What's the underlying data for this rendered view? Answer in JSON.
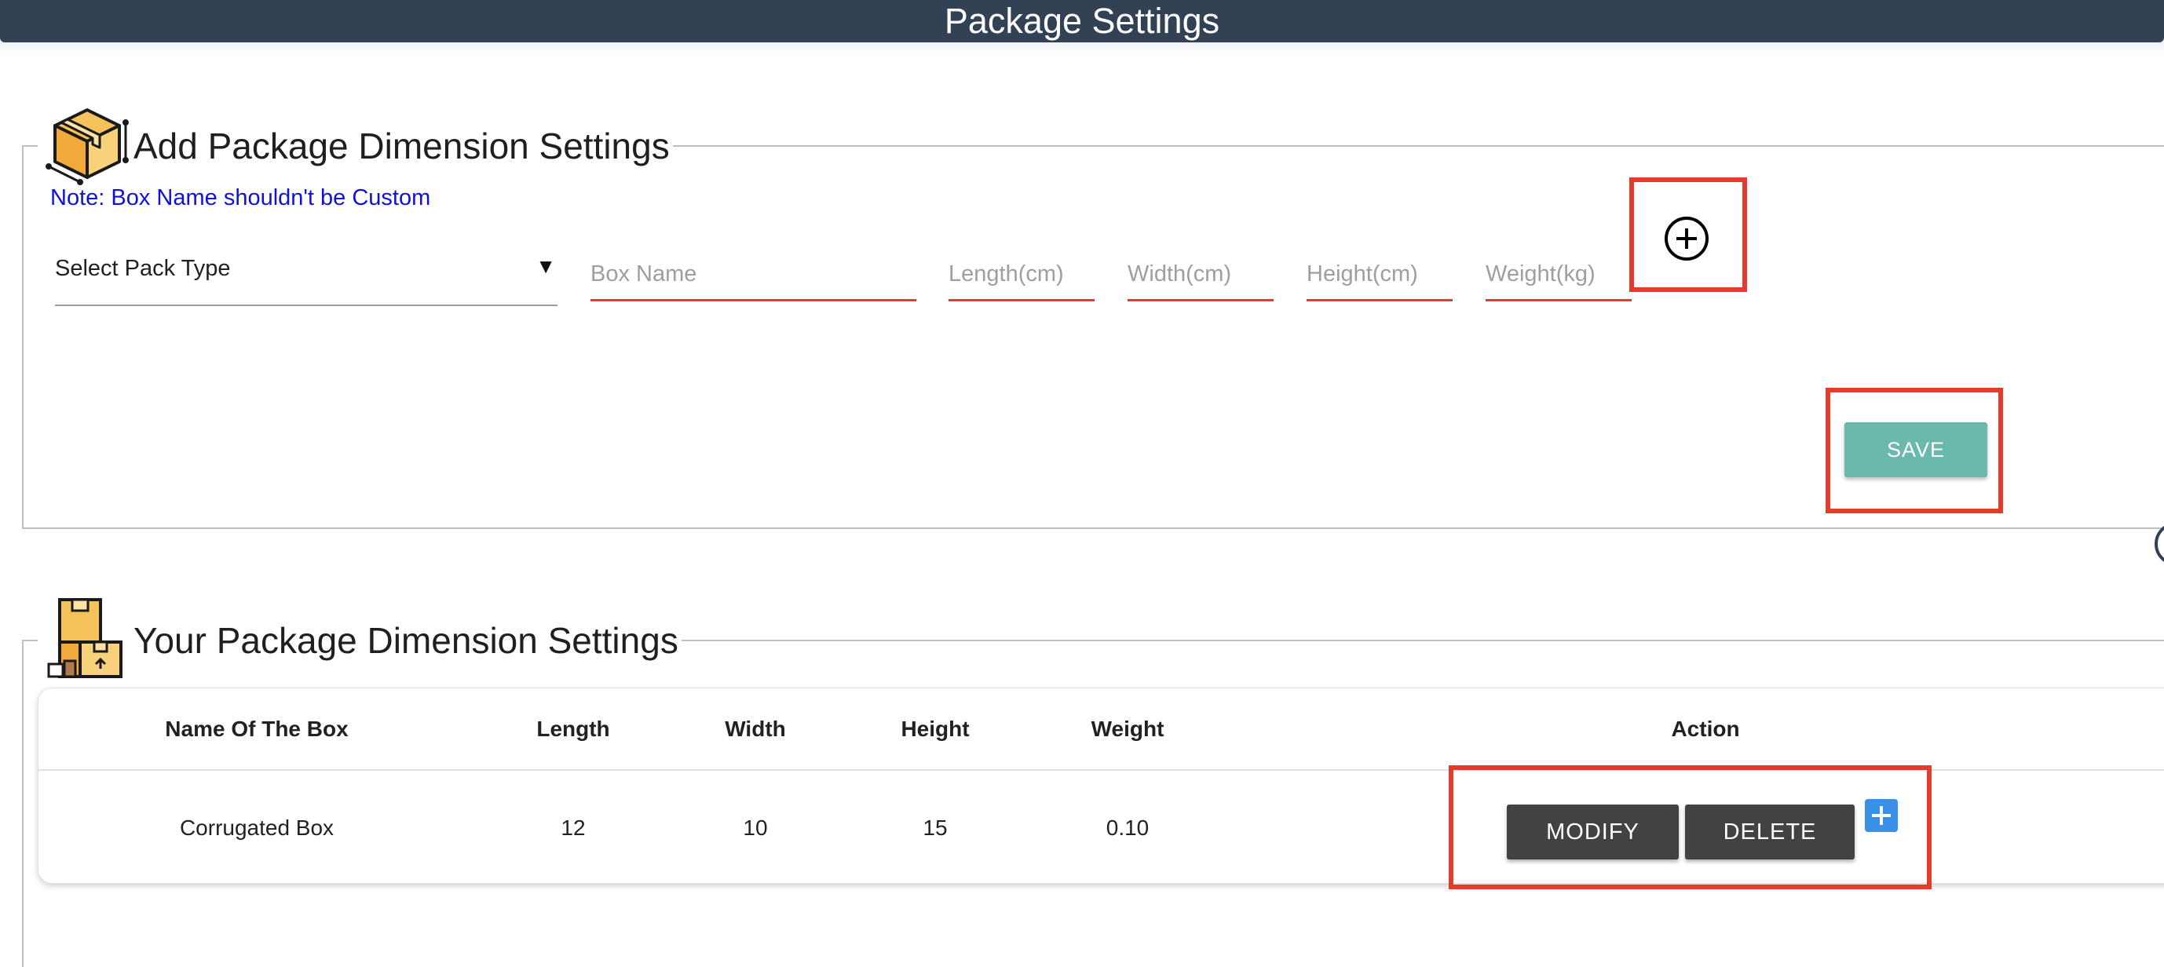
{
  "header": {
    "title": "Package Settings"
  },
  "add_section": {
    "title": "Add Package Dimension Settings",
    "icon": "package-box-icon",
    "note": "Note: Box Name shouldn't be Custom",
    "pack_type_select": {
      "value": "Select Pack Type"
    },
    "fields": {
      "box_name_placeholder": "Box Name",
      "length_placeholder": "Length(cm)",
      "width_placeholder": "Width(cm)",
      "height_placeholder": "Height(cm)",
      "weight_placeholder": "Weight(kg)"
    },
    "add_icon": "plus-circle-icon",
    "save_label": "SAVE"
  },
  "list_section": {
    "title": "Your Package Dimension Settings",
    "icon": "stacked-boxes-icon",
    "table": {
      "headers": [
        "Name Of The Box",
        "Length",
        "Width",
        "Height",
        "Weight",
        "Action"
      ],
      "rows": [
        {
          "name": "Corrugated Box",
          "length": "12",
          "width": "10",
          "height": "15",
          "weight": "0.10"
        }
      ],
      "actions": {
        "modify_label": "MODIFY",
        "delete_label": "DELETE",
        "add_icon": "plus-square-icon"
      }
    }
  },
  "colors": {
    "header_bg": "#334155",
    "note_text": "#1010d8",
    "input_underline": "#e53935",
    "save_button": "#6bb8ac",
    "action_buttons": "#424242",
    "add_square": "#3a8fe6",
    "highlight_box": "#e53b2a"
  }
}
